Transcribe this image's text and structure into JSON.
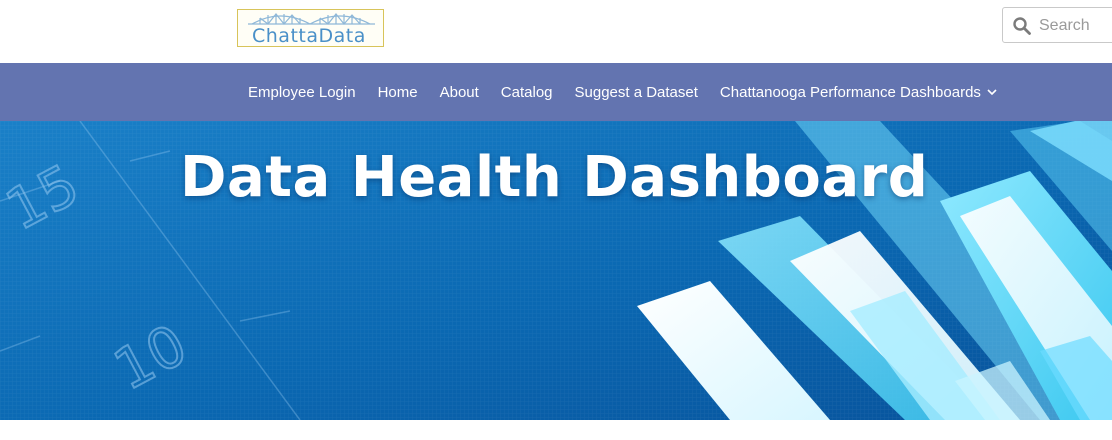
{
  "logo": {
    "text": "ChattaData",
    "icon": "bridge-logo-icon"
  },
  "search": {
    "placeholder": "Search",
    "value": "",
    "icon": "search-icon"
  },
  "nav": {
    "items": [
      {
        "label": "Employee Login"
      },
      {
        "label": "Home"
      },
      {
        "label": "About"
      },
      {
        "label": "Catalog"
      },
      {
        "label": "Suggest a Dataset"
      },
      {
        "label": "Chattanooga Performance Dashboards",
        "icon": "chevron-down-icon"
      }
    ]
  },
  "hero": {
    "title": "Data Health Dashboard",
    "axis_numbers": [
      "15",
      "10"
    ]
  },
  "colors": {
    "nav_bg": "#6374b0",
    "hero_bg": "#0b6fb8",
    "logo_border": "#d8c45a",
    "logo_text": "#4a90c8"
  }
}
